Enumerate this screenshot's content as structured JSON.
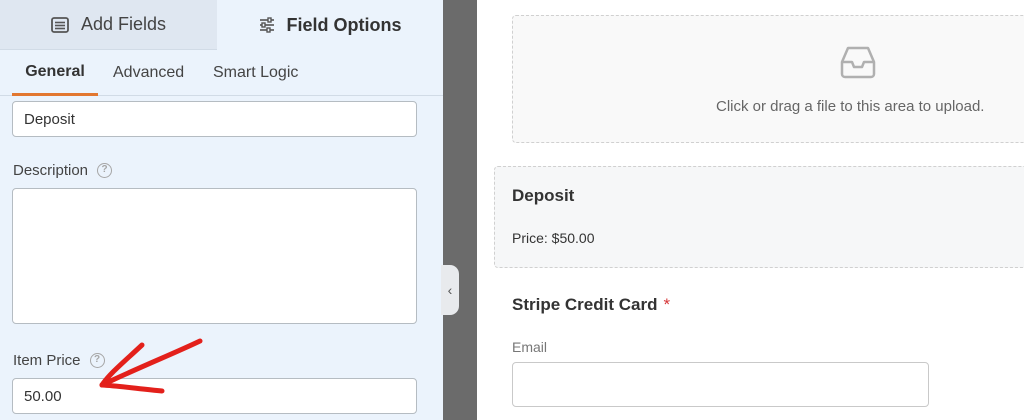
{
  "tabs": {
    "add_fields": "Add Fields",
    "field_options": "Field Options"
  },
  "subtabs": {
    "general": "General",
    "advanced": "Advanced",
    "smart_logic": "Smart Logic"
  },
  "fields": {
    "label_value": "Deposit",
    "description_label": "Description",
    "item_price_label": "Item Price",
    "item_price_value": "50.00",
    "help_glyph": "?"
  },
  "preview": {
    "upload_text": "Click or drag a file to this area to upload.",
    "deposit_title": "Deposit",
    "deposit_price": "Price: $50.00",
    "stripe_title": "Stripe Credit Card",
    "required_mark": "*",
    "email_label": "Email"
  },
  "colors": {
    "accent": "#e27730",
    "required": "#d63638",
    "annotation": "#e3201b"
  },
  "icons": [
    "list-icon",
    "sliders-icon",
    "help-icon",
    "inbox-icon",
    "chevron-left-icon",
    "red-arrow-annotation"
  ]
}
